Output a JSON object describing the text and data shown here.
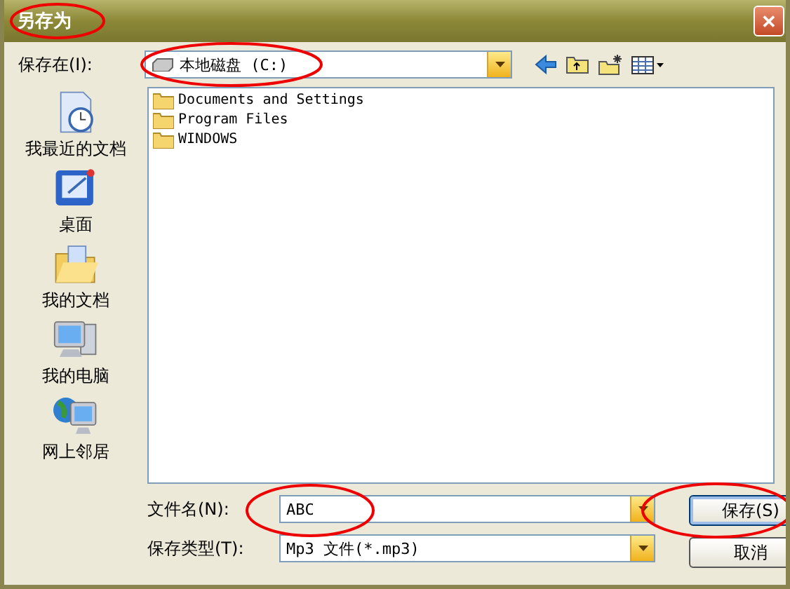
{
  "window": {
    "title": "另存为",
    "close": "✕"
  },
  "save_in": {
    "label": "保存在(I):",
    "value": "本地磁盘 (C:)"
  },
  "places": [
    {
      "label": "我最近的文档",
      "kind": "recent"
    },
    {
      "label": "桌面",
      "kind": "desktop"
    },
    {
      "label": "我的文档",
      "kind": "documents"
    },
    {
      "label": "我的电脑",
      "kind": "computer"
    },
    {
      "label": "网上邻居",
      "kind": "network"
    }
  ],
  "files": [
    {
      "name": "Documents and Settings"
    },
    {
      "name": "Program Files"
    },
    {
      "name": "WINDOWS"
    }
  ],
  "file_name": {
    "label": "文件名(N):",
    "value": "ABC"
  },
  "file_type": {
    "label": "保存类型(T):",
    "value": "Mp3 文件(*.mp3)"
  },
  "buttons": [
    {
      "label": "保存(S)",
      "default": true
    },
    {
      "label": "取消",
      "default": false
    }
  ]
}
